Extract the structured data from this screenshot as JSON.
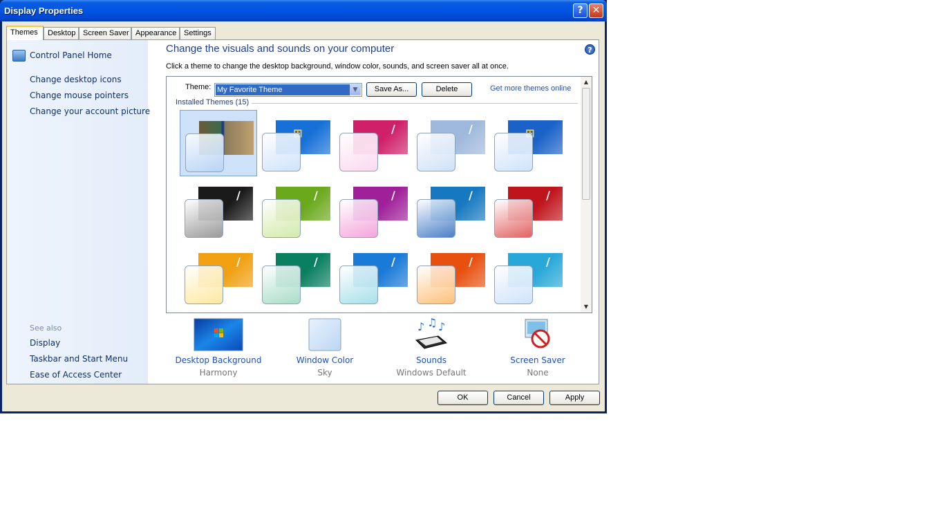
{
  "window": {
    "title": "Display Properties",
    "help_glyph": "?",
    "close_glyph": "✕"
  },
  "tabs": [
    "Themes",
    "Desktop",
    "Screen Saver",
    "Appearance",
    "Settings"
  ],
  "left_nav": {
    "home": "Control Panel Home",
    "links": [
      "Change desktop icons",
      "Change mouse pointers",
      "Change your account picture"
    ],
    "see_also_label": "See also",
    "see_also": [
      "Display",
      "Taskbar and Start Menu",
      "Ease of Access Center"
    ]
  },
  "content": {
    "heading": "Change the visuals and sounds on your computer",
    "subtitle": "Click a theme to change the desktop background, window color, sounds, and screen saver all at once.",
    "theme_label": "Theme:",
    "theme_value": "My Favorite Theme",
    "save_as": "Save As...",
    "delete": "Delete",
    "online_link": "Get more themes online",
    "installed": "Installed Themes (15)",
    "help_glyph": "?"
  },
  "themes": [
    {
      "bg": "#2f4fa0",
      "glass": "#b8d4f5",
      "selected": true,
      "icon": "custom-photo"
    },
    {
      "bg": "#1670d8",
      "glass": "#cfe3fb",
      "icon": "windows-logo"
    },
    {
      "bg": "#d0206a",
      "glass": "#fbd9ef",
      "icon": "flare"
    },
    {
      "bg": "#9fb9dc",
      "glass": "#cfe1f7",
      "icon": "flare"
    },
    {
      "bg": "#1a62c8",
      "glass": "#cfe3fb",
      "icon": "windows-logo"
    },
    {
      "bg": "#1a1a1a",
      "glass": "#9a9a9a",
      "icon": "flare"
    },
    {
      "bg": "#6aa81c",
      "glass": "#d2eaaa",
      "icon": "flare"
    },
    {
      "bg": "#a0209a",
      "glass": "#f4a5dc",
      "icon": "flare"
    },
    {
      "bg": "#1678c0",
      "glass": "#4b80c8",
      "icon": "flare"
    },
    {
      "bg": "#c0141c",
      "glass": "#e26262",
      "icon": "flare"
    },
    {
      "bg": "#f0a010",
      "glass": "#fde8a0",
      "icon": "flare"
    },
    {
      "bg": "#0a8060",
      "glass": "#a8dcc8",
      "icon": "flare"
    },
    {
      "bg": "#1a7ad8",
      "glass": "#a6e0ea",
      "icon": "flare"
    },
    {
      "bg": "#e85010",
      "glass": "#fdc07a",
      "icon": "flare"
    },
    {
      "bg": "#28a8d8",
      "glass": "#cfe3fb",
      "icon": "flare"
    }
  ],
  "features": [
    {
      "label": "Desktop Background",
      "value": "Harmony",
      "icon": "desktop-background-icon"
    },
    {
      "label": "Window Color",
      "value": "Sky",
      "icon": "window-color-icon"
    },
    {
      "label": "Sounds",
      "value": "Windows Default",
      "icon": "sounds-icon"
    },
    {
      "label": "Screen Saver",
      "value": "None",
      "icon": "screen-saver-icon"
    }
  ],
  "buttons": {
    "ok": "OK",
    "cancel": "Cancel",
    "apply": "Apply"
  },
  "colors": {
    "title_bar": "#0054e3",
    "link": "#1e50b4",
    "heading": "#1e3f8b",
    "selection": "#316ac5"
  }
}
